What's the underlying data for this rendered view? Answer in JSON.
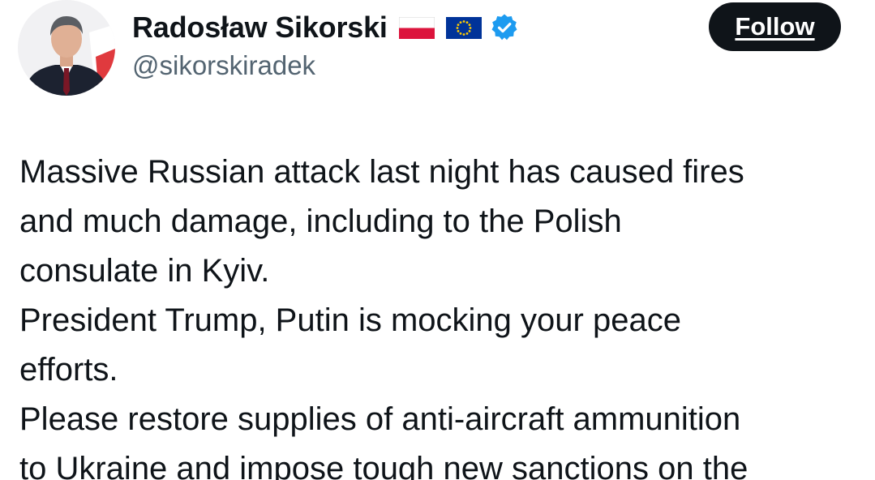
{
  "author": {
    "display_name": "Radosław Sikorski",
    "handle": "@sikorskiradek",
    "badges": [
      "flag-poland-icon",
      "flag-eu-icon",
      "verified-badge-icon"
    ]
  },
  "actions": {
    "follow_label": "Follow"
  },
  "tweet": {
    "lines": [
      "Massive Russian attack last night has caused fires",
      "and much damage, including to the Polish",
      "consulate in Kyiv.",
      "President Trump, Putin is mocking your peace",
      "efforts.",
      "Please restore supplies of anti-aircraft ammunition",
      "to Ukraine and impose tough new sanctions on the"
    ]
  },
  "colors": {
    "text": "#0f1419",
    "secondary_text": "#536471",
    "follow_button_bg": "#0f1419",
    "verified_blue": "#1d9bf0",
    "poland_red": "#dc143c",
    "eu_blue": "#003399",
    "eu_gold": "#ffcc00"
  }
}
